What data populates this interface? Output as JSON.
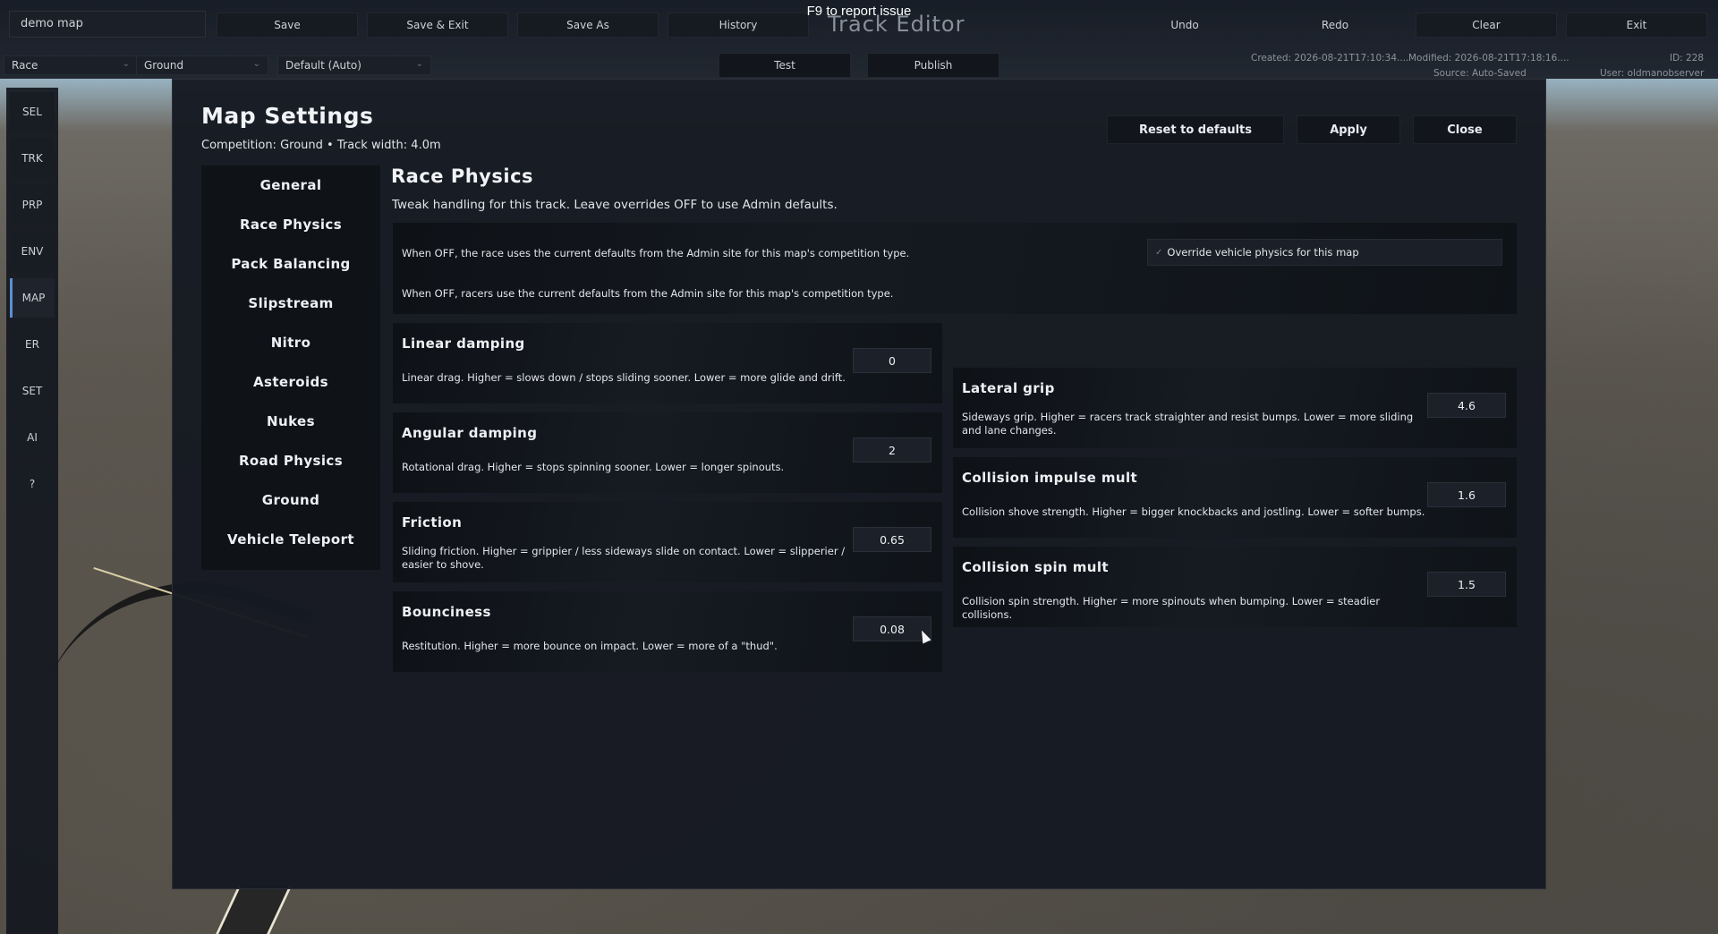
{
  "topbar": {
    "map_name": "demo map",
    "report_hint": "F9 to report issue",
    "editor_title": "Track Editor",
    "buttons": {
      "save": "Save",
      "save_exit": "Save & Exit",
      "save_as": "Save As",
      "history": "History",
      "undo": "Undo",
      "redo": "Redo",
      "clear": "Clear",
      "exit": "Exit",
      "test": "Test",
      "publish": "Publish"
    },
    "dropdowns": {
      "mode": "Race",
      "surface": "Ground",
      "preset": "Default (Auto)"
    },
    "meta": {
      "created": "Created: 2026-08-21T17:10:34....",
      "modified": "Modified: 2026-08-21T17:18:16....",
      "source": "Source: Auto-Saved",
      "id": "ID: 228",
      "user": "User: oldmanobserver"
    }
  },
  "rail": [
    "SEL",
    "TRK",
    "PRP",
    "ENV",
    "MAP",
    "ER",
    "SET",
    "AI",
    "?"
  ],
  "modal": {
    "title": "Map Settings",
    "subtitle": "Competition: Ground • Track width: 4.0m",
    "reset_label": "Reset to defaults",
    "apply_label": "Apply",
    "close_label": "Close",
    "categories": [
      "General",
      "Race Physics",
      "Pack Balancing",
      "Slipstream",
      "Nitro",
      "Asteroids",
      "Nukes",
      "Road Physics",
      "Ground",
      "Vehicle Teleport"
    ],
    "section": {
      "title": "Race Physics",
      "subtitle": "Tweak handling for this track. Leave overrides OFF to use Admin defaults.",
      "override_note_1": "When OFF, the race uses the current defaults from the Admin site for this map's competition type.",
      "override_note_2": "When OFF, racers use the current defaults from the Admin site for this map's competition type.",
      "override_label": "Override vehicle physics for this map"
    },
    "params_left": [
      {
        "title": "Linear damping",
        "desc": "Linear drag. Higher = slows down / stops sliding sooner. Lower = more glide and drift.",
        "value": "0"
      },
      {
        "title": "Angular damping",
        "desc": "Rotational drag. Higher = stops spinning sooner. Lower = longer spinouts.",
        "value": "2"
      },
      {
        "title": "Friction",
        "desc": "Sliding friction. Higher = grippier / less sideways slide on contact. Lower = slipperier / easier to shove.",
        "value": "0.65"
      },
      {
        "title": "Bounciness",
        "desc": "Restitution. Higher = more bounce on impact. Lower = more of a \"thud\".",
        "value": "0.08"
      }
    ],
    "params_right": [
      {
        "title": "Lateral grip",
        "desc": "Sideways grip. Higher = racers track straighter and resist bumps. Lower = more sliding and lane changes.",
        "value": "4.6"
      },
      {
        "title": "Collision impulse mult",
        "desc": "Collision shove strength. Higher = bigger knockbacks and jostling. Lower = softer bumps.",
        "value": "1.6"
      },
      {
        "title": "Collision spin mult",
        "desc": "Collision spin strength. Higher = more spinouts when bumping. Lower = steadier collisions.",
        "value": "1.5"
      }
    ]
  }
}
